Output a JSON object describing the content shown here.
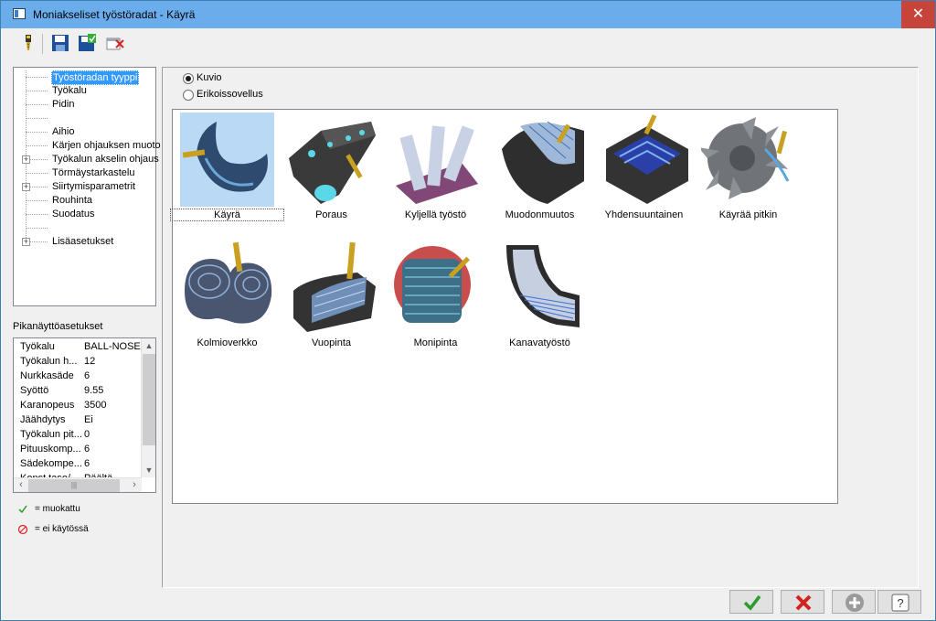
{
  "window": {
    "title": "Moniakseliset työstöradat - Käyrä",
    "close_glyph": "✕"
  },
  "toolbar": {
    "icons": [
      "tool-icon",
      "save-icon",
      "save-as-icon",
      "delete-icon"
    ]
  },
  "tree": {
    "items": [
      {
        "label": "Työstöradan tyyppi",
        "selected": true,
        "expandable": false
      },
      {
        "label": "Työkalu",
        "expandable": false
      },
      {
        "label": "Pidin",
        "expandable": false
      },
      {
        "label": "",
        "expandable": false
      },
      {
        "label": "Aihio",
        "expandable": false
      },
      {
        "label": "Kärjen ohjauksen muoto",
        "expandable": false
      },
      {
        "label": "Työkalun akselin ohjaus",
        "expandable": true
      },
      {
        "label": "Törmäystarkastelu",
        "expandable": false
      },
      {
        "label": "Siirtymisparametrit",
        "expandable": true
      },
      {
        "label": "Rouhinta",
        "expandable": false
      },
      {
        "label": "Suodatus",
        "expandable": false
      },
      {
        "label": "",
        "expandable": false
      },
      {
        "label": "Lisäasetukset",
        "expandable": true
      }
    ]
  },
  "quick": {
    "title": "Pikanäyttöasetukset",
    "rows": [
      {
        "key": "Työkalu",
        "value": "BALL-NOSE ..."
      },
      {
        "key": "Työkalun h...",
        "value": "12"
      },
      {
        "key": "Nurkkasäde",
        "value": "6"
      },
      {
        "key": "Syöttö",
        "value": "9.55"
      },
      {
        "key": "Karanopeus",
        "value": "3500"
      },
      {
        "key": "Jäähdytys",
        "value": "Ei"
      },
      {
        "key": "Työkalun pit...",
        "value": "0"
      },
      {
        "key": "Pituuskomp...",
        "value": "6"
      },
      {
        "key": "Sädekompe...",
        "value": "6"
      },
      {
        "key": "Konst.taso/...",
        "value": "Päältä"
      }
    ]
  },
  "legend": {
    "modified": "= muokattu",
    "disabled": "= ei käytössä"
  },
  "radios": [
    {
      "label": "Kuvio",
      "checked": true
    },
    {
      "label": "Erikoissovellus",
      "checked": false
    }
  ],
  "gallery": {
    "items": [
      {
        "label": "Käyrä",
        "selected": true
      },
      {
        "label": "Poraus"
      },
      {
        "label": "Kyljellä työstö"
      },
      {
        "label": "Muodonmuutos"
      },
      {
        "label": "Yhdensuuntainen"
      },
      {
        "label": "Käyrää pitkin"
      },
      {
        "label": "Kolmioverkko"
      },
      {
        "label": "Vuopinta"
      },
      {
        "label": "Monipinta"
      },
      {
        "label": "Kanavatyöstö"
      }
    ]
  },
  "buttons": [
    "ok-icon",
    "cancel-icon",
    "add-icon",
    "help-icon"
  ],
  "colors": {
    "titlebar": "#6badec",
    "close": "#c7443a",
    "selection": "#3399ff",
    "ok_green": "#2d9b2d",
    "cancel_red": "#d22222"
  }
}
